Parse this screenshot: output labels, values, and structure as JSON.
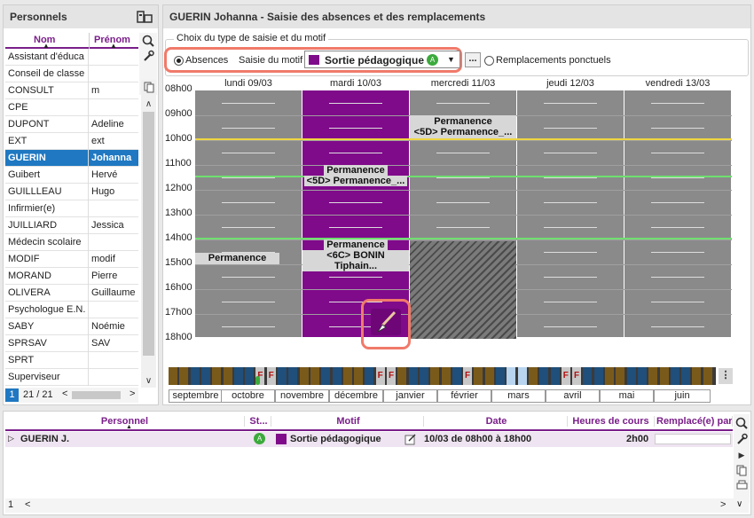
{
  "left": {
    "title": "Personnels",
    "col_nom": "Nom",
    "col_prenom": "Prénom",
    "rows": [
      [
        "Assistant d'éduca",
        ""
      ],
      [
        "Conseil de classe",
        ""
      ],
      [
        "CONSULT",
        "m"
      ],
      [
        "CPE",
        ""
      ],
      [
        "DUPONT",
        "Adeline"
      ],
      [
        "EXT",
        "ext"
      ],
      [
        "GUERIN",
        "Johanna"
      ],
      [
        "Guibert",
        "Hervé"
      ],
      [
        "GUILLLEAU",
        "Hugo"
      ],
      [
        "Infirmier(e)",
        ""
      ],
      [
        "JUILLIARD",
        "Jessica"
      ],
      [
        "Médecin scolaire",
        ""
      ],
      [
        "MODIF",
        "modif"
      ],
      [
        "MORAND",
        "Pierre"
      ],
      [
        "OLIVERA",
        "Guillaume"
      ],
      [
        "Psychologue E.N.",
        ""
      ],
      [
        "SABY",
        "Noémie"
      ],
      [
        "SPRSAV",
        "SAV"
      ],
      [
        "SPRT",
        ""
      ],
      [
        "Superviseur",
        ""
      ]
    ],
    "page_badge": "1",
    "page_count": "21 / 21"
  },
  "main": {
    "title": "GUERIN Johanna - Saisie des absences et des remplacements",
    "group_label": "Choix du type de saisie et du motif",
    "radio_absences": "Absences",
    "motif_label": "Saisie du motif",
    "motif_value": "Sortie pédagogique",
    "motif_badge": "A",
    "ellipsis": "...",
    "radio_remplacements": "Remplacements ponctuels",
    "days": [
      "lundi 09/03",
      "mardi 10/03",
      "mercredi 11/03",
      "jeudi 12/03",
      "vendredi 13/03"
    ],
    "hours": [
      "08h00",
      "09h00",
      "10h00",
      "11h00",
      "12h00",
      "13h00",
      "14h00",
      "15h00",
      "16h00",
      "17h00",
      "18h00"
    ],
    "events": {
      "e1a": "Permanence",
      "e1b": "<5D> Permanence_...",
      "e2a": "Permanence",
      "e2b": "<5D> Permanence_...",
      "e3a": "Permanence",
      "e3b": "<6C> BONIN Tiphain...",
      "e4": "Permanence"
    },
    "chip_letter": "F",
    "months": [
      "septembre",
      "octobre",
      "novembre",
      "décembre",
      "janvier",
      "février",
      "mars",
      "avril",
      "mai",
      "juin"
    ],
    "colors": {
      "purple": "#7f0a8a",
      "yellow": "#f0d640",
      "green": "#6fe06f",
      "highlight": "#f07a6a"
    }
  },
  "bottom": {
    "headers": [
      "Personnel",
      "St...",
      "Motif",
      "Date",
      "Heures de cours",
      "Remplacé(e) par"
    ],
    "row": {
      "personnel": "GUERIN J.",
      "status": "A",
      "motif": "Sortie pédagogique",
      "date": "10/03 de 08h00 à 18h00",
      "heures": "2h00",
      "remplace": ""
    },
    "page_badge": "1"
  }
}
